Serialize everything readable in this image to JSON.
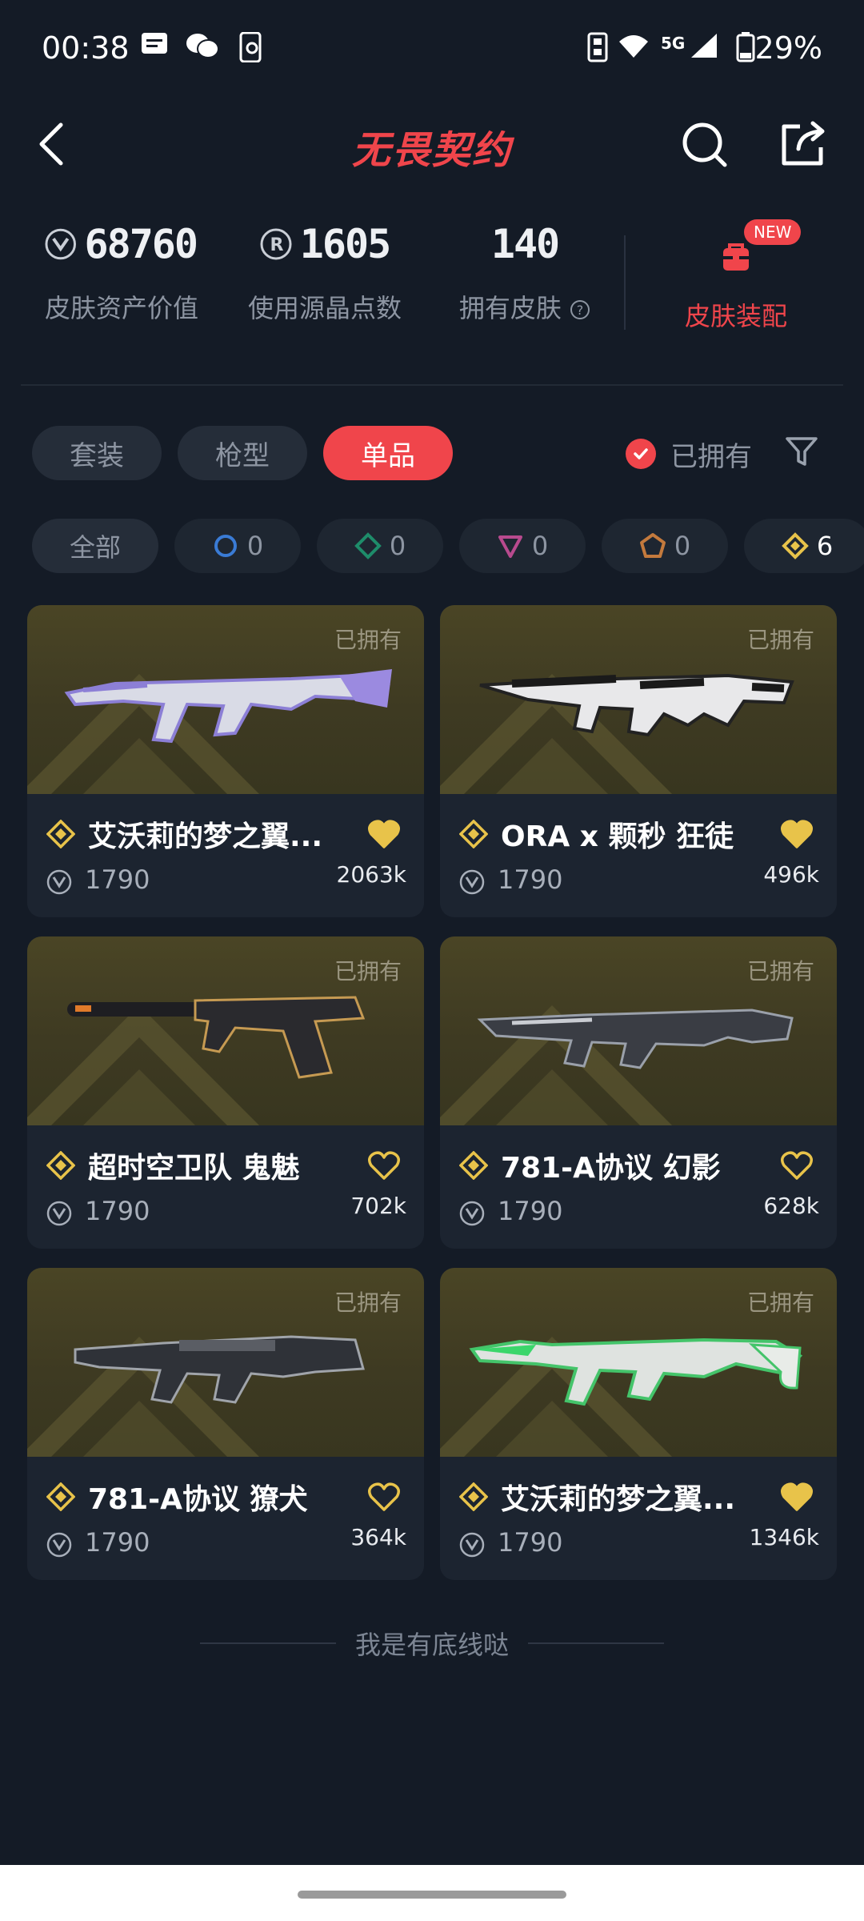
{
  "status_bar": {
    "time": "00:38",
    "network": "5G",
    "battery": "29%"
  },
  "header": {
    "title": "无畏契约"
  },
  "stats": {
    "asset_value": "68760",
    "asset_value_label": "皮肤资产价值",
    "radianite": "1605",
    "radianite_label": "使用源晶点数",
    "owned_count": "140",
    "owned_label": "拥有皮肤",
    "loadout_label": "皮肤装配",
    "new_badge": "NEW"
  },
  "tabs": [
    {
      "label": "套装",
      "active": false
    },
    {
      "label": "枪型",
      "active": false
    },
    {
      "label": "单品",
      "active": true
    }
  ],
  "owned_filter": {
    "label": "已拥有",
    "checked": true
  },
  "chips": [
    {
      "label": "全部"
    },
    {
      "icon": "ring-blue-icon",
      "count": "0",
      "color": "#3a7bd5"
    },
    {
      "icon": "diamond-green-icon",
      "count": "0",
      "color": "#1e8c6a"
    },
    {
      "icon": "triangle-pink-icon",
      "count": "0",
      "color": "#b84a8e"
    },
    {
      "icon": "pentagon-orange-icon",
      "count": "0",
      "color": "#c47a3d"
    },
    {
      "icon": "diamond-gold-icon",
      "count": "6",
      "color": "#e8c34a"
    }
  ],
  "items": [
    {
      "tag": "已拥有",
      "name": "艾沃莉的梦之翼...",
      "price": "1790",
      "likes": "2063k",
      "liked": true,
      "gun": "vandal-lavender"
    },
    {
      "tag": "已拥有",
      "name": "ORA x 颗秒 狂徒",
      "price": "1790",
      "likes": "496k",
      "liked": true,
      "gun": "vandal-bw"
    },
    {
      "tag": "已拥有",
      "name": "超时空卫队 鬼魅",
      "price": "1790",
      "likes": "702k",
      "liked": false,
      "gun": "ghost"
    },
    {
      "tag": "已拥有",
      "name": "781-A协议 幻影",
      "price": "1790",
      "likes": "628k",
      "liked": false,
      "gun": "phantom"
    },
    {
      "tag": "已拥有",
      "name": "781-A协议 獠犬",
      "price": "1790",
      "likes": "364k",
      "liked": false,
      "gun": "bulldog"
    },
    {
      "tag": "已拥有",
      "name": "艾沃莉的梦之翼...",
      "price": "1790",
      "likes": "1346k",
      "liked": true,
      "gun": "vandal-green"
    }
  ],
  "footer": {
    "text": "我是有底线哒"
  },
  "colors": {
    "accent": "#f0454b",
    "gold": "#e8c34a",
    "bg": "#141b26"
  }
}
